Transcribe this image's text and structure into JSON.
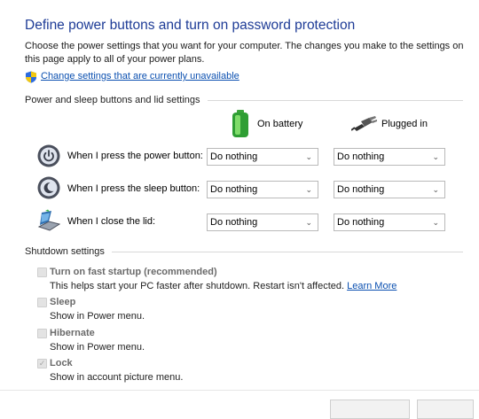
{
  "header": {
    "title": "Define power buttons and turn on password protection",
    "description": "Choose the power settings that you want for your computer. The changes you make to the settings on this page apply to all of your power plans.",
    "change_link": "Change settings that are currently unavailable"
  },
  "buttons_section": {
    "heading": "Power and sleep buttons and lid settings",
    "columns": {
      "battery": "On battery",
      "plugged": "Plugged in"
    },
    "rows": [
      {
        "label": "When I press the power button:",
        "battery": "Do nothing",
        "plugged": "Do nothing",
        "icon": "power-button-icon"
      },
      {
        "label": "When I press the sleep button:",
        "battery": "Do nothing",
        "plugged": "Do nothing",
        "icon": "sleep-button-icon"
      },
      {
        "label": "When I close the lid:",
        "battery": "Do nothing",
        "plugged": "Do nothing",
        "icon": "laptop-lid-icon"
      }
    ]
  },
  "shutdown_section": {
    "heading": "Shutdown settings",
    "options": [
      {
        "title": "Turn on fast startup (recommended)",
        "desc": "This helps start your PC faster after shutdown. Restart isn't affected.",
        "link": "Learn More",
        "checked": false
      },
      {
        "title": "Sleep",
        "desc": "Show in Power menu.",
        "checked": false
      },
      {
        "title": "Hibernate",
        "desc": "Show in Power menu.",
        "checked": false
      },
      {
        "title": "Lock",
        "desc": "Show in account picture menu.",
        "checked": true
      }
    ]
  },
  "colors": {
    "title": "#1d3b96",
    "link": "#0a4fb0",
    "disabled_text": "#6a6a6a"
  },
  "glyphs": {
    "chevron": "⌄",
    "check": "✓"
  }
}
